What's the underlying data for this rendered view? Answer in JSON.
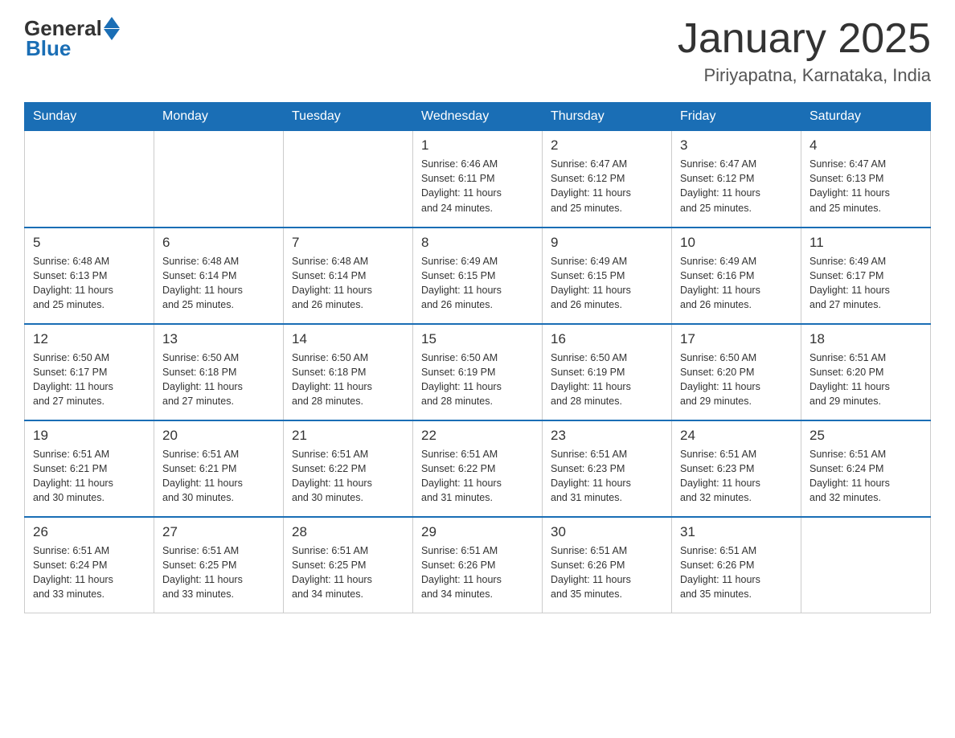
{
  "header": {
    "logo_general": "General",
    "logo_blue": "Blue",
    "title": "January 2025",
    "subtitle": "Piriyapatna, Karnataka, India"
  },
  "days_of_week": [
    "Sunday",
    "Monday",
    "Tuesday",
    "Wednesday",
    "Thursday",
    "Friday",
    "Saturday"
  ],
  "weeks": [
    [
      {
        "day": "",
        "info": ""
      },
      {
        "day": "",
        "info": ""
      },
      {
        "day": "",
        "info": ""
      },
      {
        "day": "1",
        "info": "Sunrise: 6:46 AM\nSunset: 6:11 PM\nDaylight: 11 hours\nand 24 minutes."
      },
      {
        "day": "2",
        "info": "Sunrise: 6:47 AM\nSunset: 6:12 PM\nDaylight: 11 hours\nand 25 minutes."
      },
      {
        "day": "3",
        "info": "Sunrise: 6:47 AM\nSunset: 6:12 PM\nDaylight: 11 hours\nand 25 minutes."
      },
      {
        "day": "4",
        "info": "Sunrise: 6:47 AM\nSunset: 6:13 PM\nDaylight: 11 hours\nand 25 minutes."
      }
    ],
    [
      {
        "day": "5",
        "info": "Sunrise: 6:48 AM\nSunset: 6:13 PM\nDaylight: 11 hours\nand 25 minutes."
      },
      {
        "day": "6",
        "info": "Sunrise: 6:48 AM\nSunset: 6:14 PM\nDaylight: 11 hours\nand 25 minutes."
      },
      {
        "day": "7",
        "info": "Sunrise: 6:48 AM\nSunset: 6:14 PM\nDaylight: 11 hours\nand 26 minutes."
      },
      {
        "day": "8",
        "info": "Sunrise: 6:49 AM\nSunset: 6:15 PM\nDaylight: 11 hours\nand 26 minutes."
      },
      {
        "day": "9",
        "info": "Sunrise: 6:49 AM\nSunset: 6:15 PM\nDaylight: 11 hours\nand 26 minutes."
      },
      {
        "day": "10",
        "info": "Sunrise: 6:49 AM\nSunset: 6:16 PM\nDaylight: 11 hours\nand 26 minutes."
      },
      {
        "day": "11",
        "info": "Sunrise: 6:49 AM\nSunset: 6:17 PM\nDaylight: 11 hours\nand 27 minutes."
      }
    ],
    [
      {
        "day": "12",
        "info": "Sunrise: 6:50 AM\nSunset: 6:17 PM\nDaylight: 11 hours\nand 27 minutes."
      },
      {
        "day": "13",
        "info": "Sunrise: 6:50 AM\nSunset: 6:18 PM\nDaylight: 11 hours\nand 27 minutes."
      },
      {
        "day": "14",
        "info": "Sunrise: 6:50 AM\nSunset: 6:18 PM\nDaylight: 11 hours\nand 28 minutes."
      },
      {
        "day": "15",
        "info": "Sunrise: 6:50 AM\nSunset: 6:19 PM\nDaylight: 11 hours\nand 28 minutes."
      },
      {
        "day": "16",
        "info": "Sunrise: 6:50 AM\nSunset: 6:19 PM\nDaylight: 11 hours\nand 28 minutes."
      },
      {
        "day": "17",
        "info": "Sunrise: 6:50 AM\nSunset: 6:20 PM\nDaylight: 11 hours\nand 29 minutes."
      },
      {
        "day": "18",
        "info": "Sunrise: 6:51 AM\nSunset: 6:20 PM\nDaylight: 11 hours\nand 29 minutes."
      }
    ],
    [
      {
        "day": "19",
        "info": "Sunrise: 6:51 AM\nSunset: 6:21 PM\nDaylight: 11 hours\nand 30 minutes."
      },
      {
        "day": "20",
        "info": "Sunrise: 6:51 AM\nSunset: 6:21 PM\nDaylight: 11 hours\nand 30 minutes."
      },
      {
        "day": "21",
        "info": "Sunrise: 6:51 AM\nSunset: 6:22 PM\nDaylight: 11 hours\nand 30 minutes."
      },
      {
        "day": "22",
        "info": "Sunrise: 6:51 AM\nSunset: 6:22 PM\nDaylight: 11 hours\nand 31 minutes."
      },
      {
        "day": "23",
        "info": "Sunrise: 6:51 AM\nSunset: 6:23 PM\nDaylight: 11 hours\nand 31 minutes."
      },
      {
        "day": "24",
        "info": "Sunrise: 6:51 AM\nSunset: 6:23 PM\nDaylight: 11 hours\nand 32 minutes."
      },
      {
        "day": "25",
        "info": "Sunrise: 6:51 AM\nSunset: 6:24 PM\nDaylight: 11 hours\nand 32 minutes."
      }
    ],
    [
      {
        "day": "26",
        "info": "Sunrise: 6:51 AM\nSunset: 6:24 PM\nDaylight: 11 hours\nand 33 minutes."
      },
      {
        "day": "27",
        "info": "Sunrise: 6:51 AM\nSunset: 6:25 PM\nDaylight: 11 hours\nand 33 minutes."
      },
      {
        "day": "28",
        "info": "Sunrise: 6:51 AM\nSunset: 6:25 PM\nDaylight: 11 hours\nand 34 minutes."
      },
      {
        "day": "29",
        "info": "Sunrise: 6:51 AM\nSunset: 6:26 PM\nDaylight: 11 hours\nand 34 minutes."
      },
      {
        "day": "30",
        "info": "Sunrise: 6:51 AM\nSunset: 6:26 PM\nDaylight: 11 hours\nand 35 minutes."
      },
      {
        "day": "31",
        "info": "Sunrise: 6:51 AM\nSunset: 6:26 PM\nDaylight: 11 hours\nand 35 minutes."
      },
      {
        "day": "",
        "info": ""
      }
    ]
  ]
}
